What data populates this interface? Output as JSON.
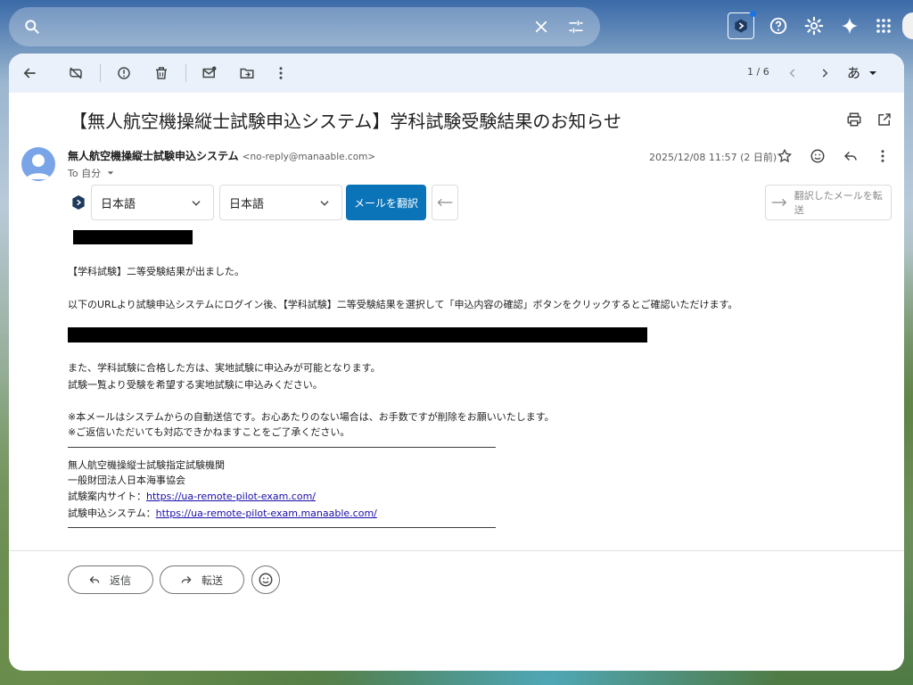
{
  "colors": {
    "translate_button": "#0b74b8",
    "link": "#1a0dab",
    "toolbar_bg": "#eaf1fb",
    "avatar": "#7aa4e8",
    "unread_dot": "#1a73e8"
  },
  "search": {
    "placeholder": "",
    "value": ""
  },
  "top_icons": [
    "close-icon",
    "tune-icon",
    "extension-icon",
    "help-icon",
    "settings-icon",
    "gemini-sparkle-icon",
    "apps-icon"
  ],
  "toolbar": {
    "pager": "1 / 6",
    "input_method": "あ"
  },
  "email": {
    "subject": "【無人航空機操縦士試験申込システム】学科試験受験結果のお知らせ",
    "sender_name": "無人航空機操縦士試験申込システム",
    "sender_email": "<no-reply@manaable.com>",
    "to": "To 自分",
    "date": "2025/12/08 11:57 (2 日前)"
  },
  "translate": {
    "source_lang": "日本語",
    "target_lang": "日本語",
    "translate_label": "メールを翻訳",
    "forward_label": "翻訳したメールを転送"
  },
  "body": {
    "line1": "【学科試験】二等受験結果が出ました。",
    "line2": "以下のURLより試験申込システムにログイン後、【学科試験】二等受験結果を選択して「申込内容の確認」ボタンをクリックするとご確認いただけます。",
    "line3": "また、学科試験に合格した方は、実地試験に申込みが可能となります。",
    "line4": "試験一覧より受験を希望する実地試験に申込みください。",
    "line5": "※本メールはシステムからの自動送信です。お心あたりのない場合は、お手数ですが削除をお願いいたします。",
    "line6": "※ご返信いただいても対応できかねますことをご了承ください。",
    "org1": "無人航空機操縦士試験指定試験機関",
    "org2": "一般財団法人日本海事協会",
    "guide_label": "試験案内サイト：",
    "guide_url": "https://ua-remote-pilot-exam.com/",
    "apply_label": "試験申込システム：",
    "apply_url": "https://ua-remote-pilot-exam.manaable.com/"
  },
  "actions": {
    "reply": "返信",
    "forward": "転送"
  }
}
